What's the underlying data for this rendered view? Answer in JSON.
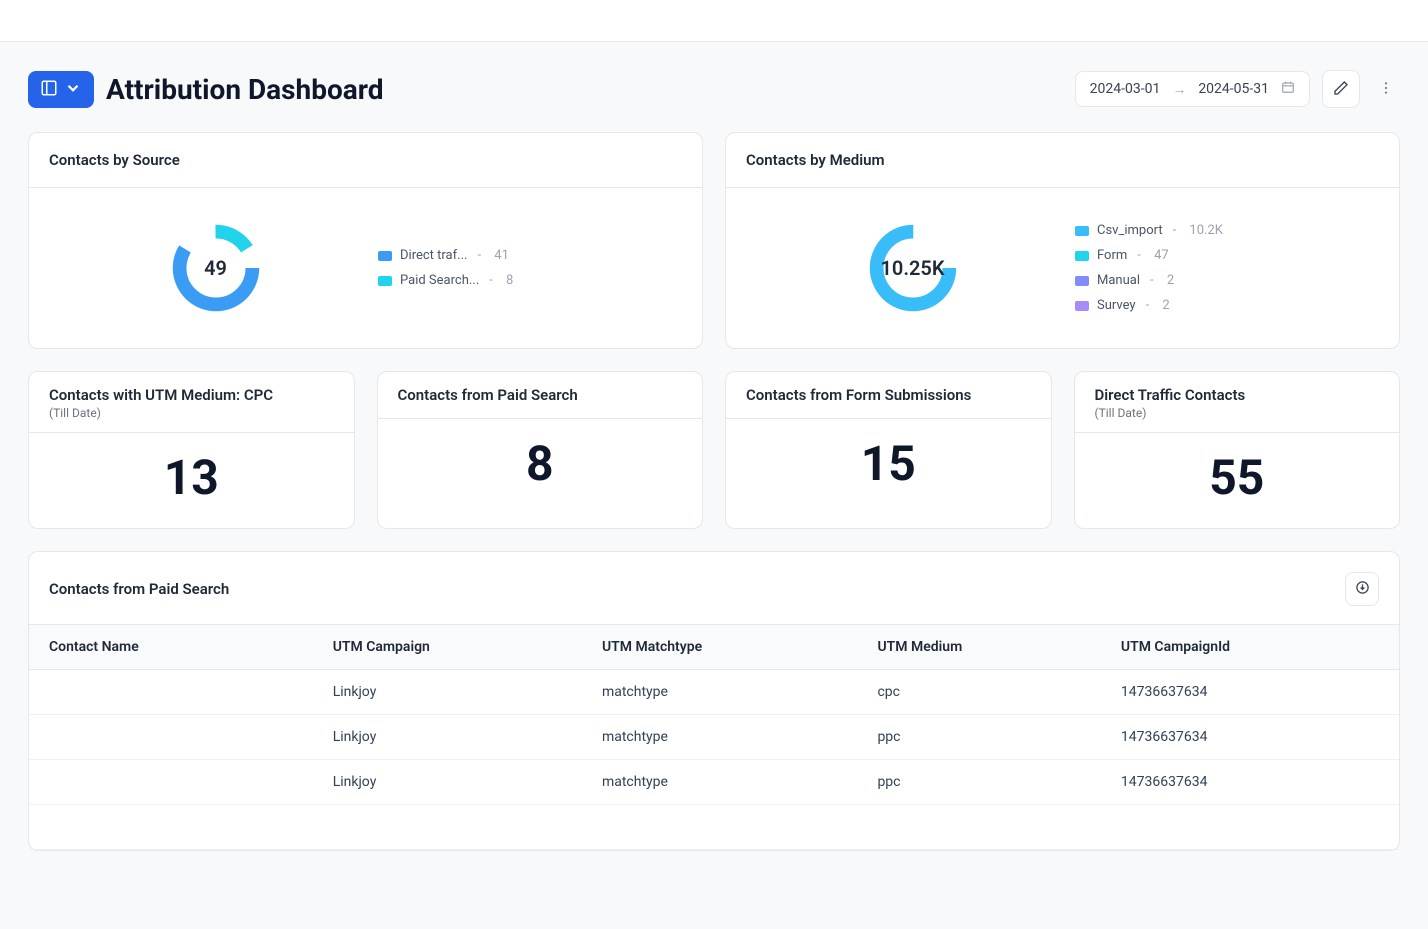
{
  "header": {
    "title": "Attribution Dashboard",
    "date_start": "2024-03-01",
    "date_end": "2024-05-31"
  },
  "charts": {
    "by_source": {
      "title": "Contacts by Source",
      "center_value": "49",
      "series": [
        {
          "label": "Direct traf...",
          "value": "41",
          "color": "#3b9cf6"
        },
        {
          "label": "Paid Search...",
          "value": "8",
          "color": "#22d3ee"
        }
      ]
    },
    "by_medium": {
      "title": "Contacts by Medium",
      "center_value": "10.25K",
      "series": [
        {
          "label": "Csv_import",
          "value": "10.2K",
          "color": "#38bdf8"
        },
        {
          "label": "Form",
          "value": "47",
          "color": "#22d3ee"
        },
        {
          "label": "Manual",
          "value": "2",
          "color": "#818cf8"
        },
        {
          "label": "Survey",
          "value": "2",
          "color": "#a78bfa"
        }
      ]
    }
  },
  "chart_data": [
    {
      "type": "pie",
      "title": "Contacts by Source",
      "series": [
        {
          "name": "Direct traffic",
          "value": 41
        },
        {
          "name": "Paid Search",
          "value": 8
        }
      ],
      "total": 49
    },
    {
      "type": "pie",
      "title": "Contacts by Medium",
      "series": [
        {
          "name": "Csv_import",
          "value": 10200
        },
        {
          "name": "Form",
          "value": 47
        },
        {
          "name": "Manual",
          "value": 2
        },
        {
          "name": "Survey",
          "value": 2
        }
      ],
      "total": 10251
    }
  ],
  "stats": [
    {
      "title": "Contacts with UTM Medium: CPC",
      "sub": "(Till Date)",
      "value": "13"
    },
    {
      "title": "Contacts from Paid Search",
      "sub": "",
      "value": "8"
    },
    {
      "title": "Contacts from Form Submissions",
      "sub": "",
      "value": "15"
    },
    {
      "title": "Direct Traffic Contacts",
      "sub": "(Till Date)",
      "value": "55"
    }
  ],
  "table": {
    "title": "Contacts from Paid Search",
    "columns": [
      "Contact Name",
      "UTM Campaign",
      "UTM Matchtype",
      "UTM Medium",
      "UTM CampaignId"
    ],
    "rows": [
      {
        "contact": "",
        "campaign": "Linkjoy",
        "matchtype": "matchtype",
        "medium": "cpc",
        "cid": "14736637634"
      },
      {
        "contact": "",
        "campaign": "Linkjoy",
        "matchtype": "matchtype",
        "medium": "ppc",
        "cid": "14736637634"
      },
      {
        "contact": "",
        "campaign": "Linkjoy",
        "matchtype": "matchtype",
        "medium": "ppc",
        "cid": "14736637634"
      }
    ]
  }
}
